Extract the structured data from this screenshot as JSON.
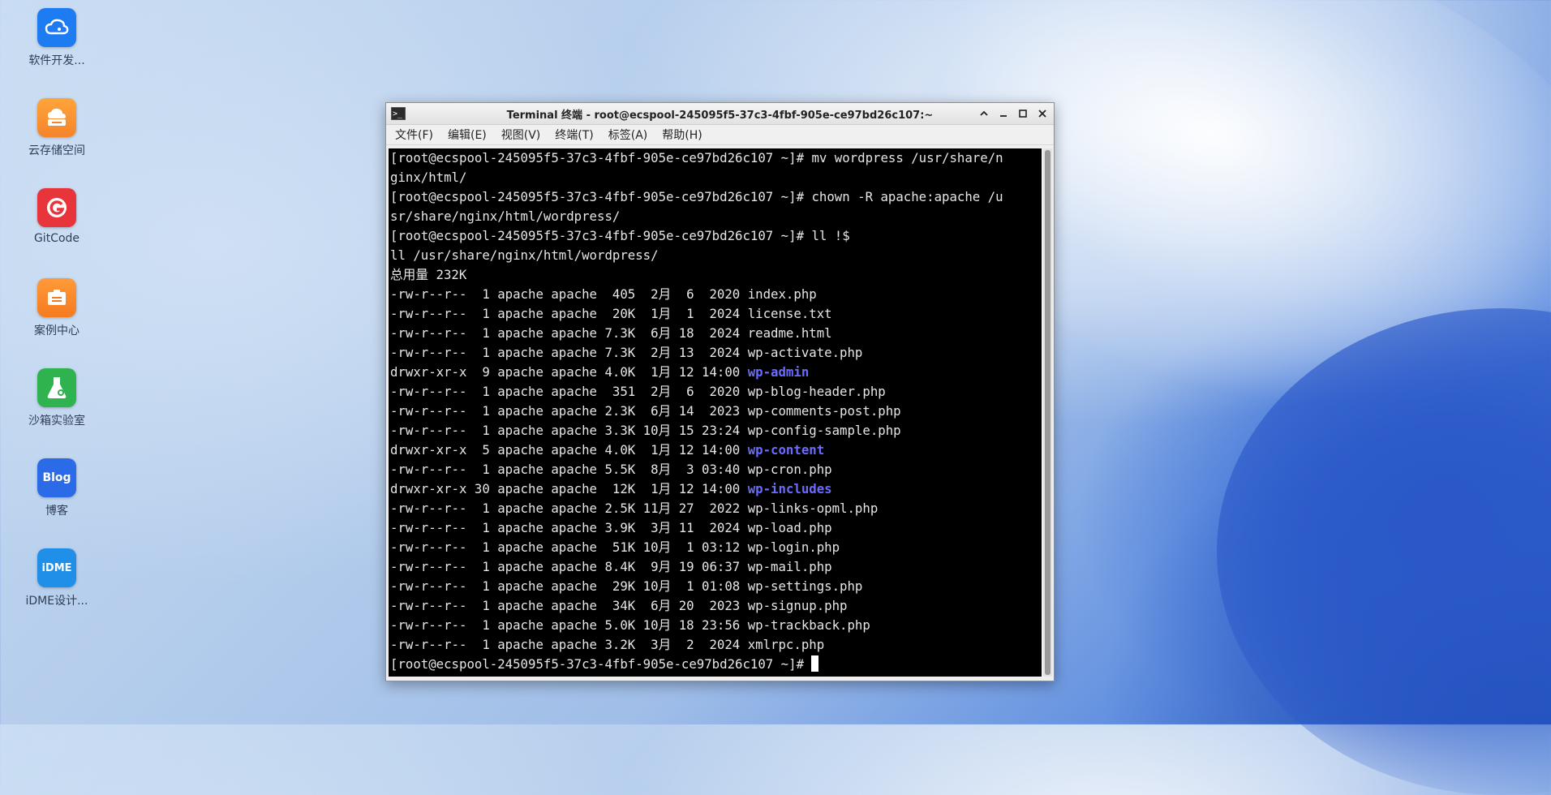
{
  "desktop": {
    "icons": [
      {
        "label": "软件开发...",
        "icon": "cloud-dev-icon",
        "color": "#1e7cf2"
      },
      {
        "label": "云存储空间",
        "icon": "cloud-storage-icon",
        "color": "#f5892a"
      },
      {
        "label": "GitCode",
        "icon": "gitcode-icon",
        "color": "#e8343b"
      },
      {
        "label": "案例中心",
        "icon": "case-center-icon",
        "color": "#f57b1f"
      },
      {
        "label": "沙箱实验室",
        "icon": "sandbox-lab-icon",
        "color": "#2fb34f"
      },
      {
        "label": "博客",
        "icon": "blog-icon",
        "color": "#2c6be8"
      },
      {
        "label": "iDME设计...",
        "icon": "idme-icon",
        "color": "#1f8fe8"
      }
    ],
    "blog_tile_text": "Blog",
    "idme_tile_text": "iDME"
  },
  "window": {
    "title": "Terminal 终端 - root@ecspool-245095f5-37c3-4fbf-905e-ce97bd26c107:~",
    "controls": [
      "collapse-icon",
      "minimize-icon",
      "maximize-icon",
      "close-icon"
    ],
    "menus": [
      "文件(F)",
      "编辑(E)",
      "视图(V)",
      "终端(T)",
      "标签(A)",
      "帮助(H)"
    ]
  },
  "terminal": {
    "lines": [
      {
        "text": "[root@ecspool-245095f5-37c3-4fbf-905e-ce97bd26c107 ~]# mv wordpress /usr/share/n"
      },
      {
        "text": "ginx/html/"
      },
      {
        "text": "[root@ecspool-245095f5-37c3-4fbf-905e-ce97bd26c107 ~]# chown -R apache:apache /u"
      },
      {
        "text": "sr/share/nginx/html/wordpress/"
      },
      {
        "text": "[root@ecspool-245095f5-37c3-4fbf-905e-ce97bd26c107 ~]# ll !$"
      },
      {
        "text": "ll /usr/share/nginx/html/wordpress/"
      },
      {
        "text": "总用量 232K"
      },
      {
        "text": "-rw-r--r--  1 apache apache  405  2月  6  2020 ",
        "name": "index.php"
      },
      {
        "text": "-rw-r--r--  1 apache apache  20K  1月  1  2024 ",
        "name": "license.txt"
      },
      {
        "text": "-rw-r--r--  1 apache apache 7.3K  6月 18  2024 ",
        "name": "readme.html"
      },
      {
        "text": "-rw-r--r--  1 apache apache 7.3K  2月 13  2024 ",
        "name": "wp-activate.php"
      },
      {
        "text": "drwxr-xr-x  9 apache apache 4.0K  1月 12 14:00 ",
        "name": "wp-admin",
        "dir": true
      },
      {
        "text": "-rw-r--r--  1 apache apache  351  2月  6  2020 ",
        "name": "wp-blog-header.php"
      },
      {
        "text": "-rw-r--r--  1 apache apache 2.3K  6月 14  2023 ",
        "name": "wp-comments-post.php"
      },
      {
        "text": "-rw-r--r--  1 apache apache 3.3K 10月 15 23:24 ",
        "name": "wp-config-sample.php"
      },
      {
        "text": "drwxr-xr-x  5 apache apache 4.0K  1月 12 14:00 ",
        "name": "wp-content",
        "dir": true
      },
      {
        "text": "-rw-r--r--  1 apache apache 5.5K  8月  3 03:40 ",
        "name": "wp-cron.php"
      },
      {
        "text": "drwxr-xr-x 30 apache apache  12K  1月 12 14:00 ",
        "name": "wp-includes",
        "dir": true
      },
      {
        "text": "-rw-r--r--  1 apache apache 2.5K 11月 27  2022 ",
        "name": "wp-links-opml.php"
      },
      {
        "text": "-rw-r--r--  1 apache apache 3.9K  3月 11  2024 ",
        "name": "wp-load.php"
      },
      {
        "text": "-rw-r--r--  1 apache apache  51K 10月  1 03:12 ",
        "name": "wp-login.php"
      },
      {
        "text": "-rw-r--r--  1 apache apache 8.4K  9月 19 06:37 ",
        "name": "wp-mail.php"
      },
      {
        "text": "-rw-r--r--  1 apache apache  29K 10月  1 01:08 ",
        "name": "wp-settings.php"
      },
      {
        "text": "-rw-r--r--  1 apache apache  34K  6月 20  2023 ",
        "name": "wp-signup.php"
      },
      {
        "text": "-rw-r--r--  1 apache apache 5.0K 10月 18 23:56 ",
        "name": "wp-trackback.php"
      },
      {
        "text": "-rw-r--r--  1 apache apache 3.2K  3月  2  2024 ",
        "name": "xmlrpc.php"
      },
      {
        "text": "[root@ecspool-245095f5-37c3-4fbf-905e-ce97bd26c107 ~]# ",
        "cursor": true
      }
    ],
    "dir_color": "#6b6bff"
  }
}
